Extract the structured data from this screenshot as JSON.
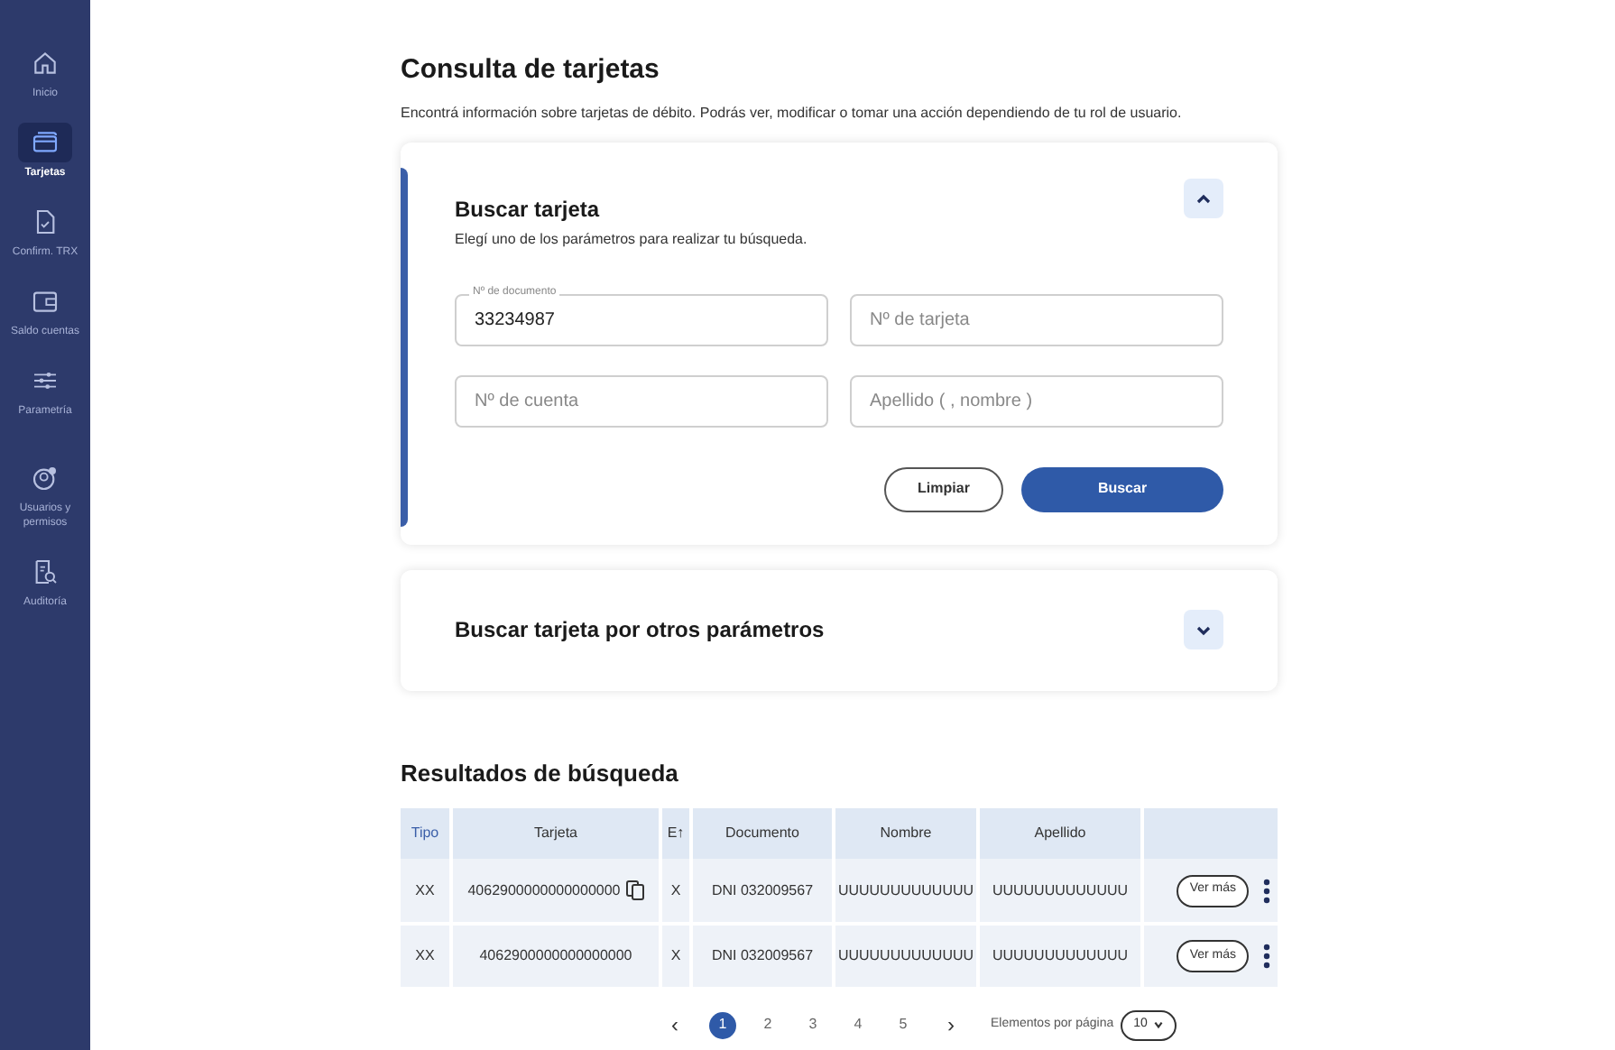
{
  "sidebar": {
    "items": [
      {
        "kind": "home",
        "label": "Inicio",
        "selected": false
      },
      {
        "kind": "card",
        "label": "Tarjetas",
        "selected": true
      },
      {
        "kind": "doc",
        "label": "Confirm. TRX",
        "selected": false
      },
      {
        "kind": "wallet",
        "label": "Saldo cuentas",
        "selected": false
      },
      {
        "kind": "sliders",
        "label": "Parametría",
        "selected": false
      },
      {
        "kind": "users",
        "label": "Usuarios y permisos",
        "selected": false
      },
      {
        "kind": "audit",
        "label": "Auditoría",
        "selected": false
      }
    ]
  },
  "page": {
    "title": "Consulta de tarjetas",
    "subtitle": "Encontrá información sobre tarjetas de débito. Podrás ver, modificar o tomar una acción dependiendo de tu rol de usuario."
  },
  "search_card": {
    "title": "Buscar tarjeta",
    "subtitle": "Elegí uno de los parámetros para realizar tu búsqueda.",
    "expanded": true,
    "fields": [
      {
        "label": "Nº de documento",
        "value": "33234987"
      },
      {
        "placeholder": "Nº de tarjeta"
      },
      {
        "placeholder": "Nº de cuenta"
      },
      {
        "placeholder": "Apellido ( , nombre )"
      }
    ],
    "buttons": [
      {
        "label": "Limpiar",
        "kind": "outline"
      },
      {
        "label": "Buscar",
        "kind": "primary"
      }
    ]
  },
  "other_card": {
    "title": "Buscar tarjeta por otros parámetros",
    "expanded": false
  },
  "results": {
    "title": "Resultados de búsqueda",
    "columns": [
      "Tipo",
      "Tarjeta",
      "E↑",
      "Documento",
      "Nombre",
      "Apellido"
    ],
    "rows": [
      {
        "cells": [
          "XX",
          "4062900000000000000",
          "X",
          "DNI 032009567",
          "UUUUUUUUUUUUU",
          "UUUUUUUUUUUUU"
        ],
        "copy_icon": true,
        "action": "Ver más"
      },
      {
        "cells": [
          "XX",
          "4062900000000000000",
          "X",
          "DNI 032009567",
          "UUUUUUUUUUUUU",
          "UUUUUUUUUUUUU"
        ],
        "copy_icon": false,
        "action": "Ver más"
      }
    ]
  },
  "pagination": {
    "prev": "‹",
    "next": "›",
    "pages": [
      {
        "label": "1",
        "selected": true
      },
      {
        "label": "2",
        "selected": false
      },
      {
        "label": "3",
        "selected": false
      },
      {
        "label": "4",
        "selected": false
      },
      {
        "label": "5",
        "selected": false
      }
    ],
    "per_page_label": "Elementos por página",
    "per_page": "10"
  }
}
